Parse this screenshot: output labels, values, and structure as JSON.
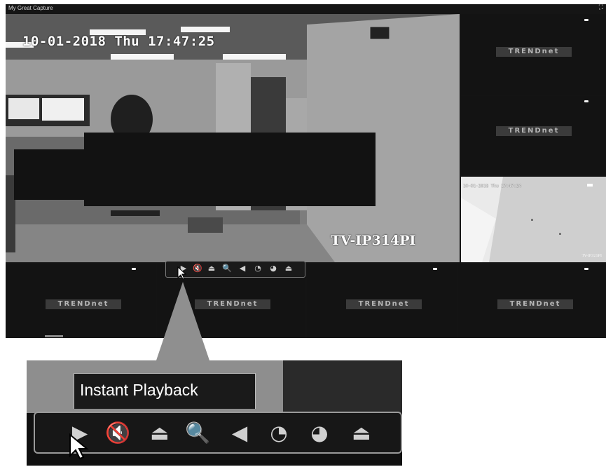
{
  "window": {
    "title": "My Great Capture",
    "controls_glyph": "⛶"
  },
  "main_camera": {
    "timestamp": "10-01-2018 Thu 17:47:25",
    "camera_label": "TV-IP314PI"
  },
  "mini_camera": {
    "timestamp": "10-01-2018 Thu 17:47:24",
    "camera_label": "TV-IP321PI"
  },
  "brand_text": "TRENDnet",
  "tiles": [
    {
      "id": "right-top",
      "brand": "TRENDnet"
    },
    {
      "id": "right-mid",
      "brand": "TRENDnet"
    },
    {
      "id": "bottom-1",
      "brand": "TRENDnet"
    },
    {
      "id": "bottom-2",
      "brand": "TRENDnet"
    },
    {
      "id": "bottom-3",
      "brand": "TRENDnet"
    },
    {
      "id": "bottom-4",
      "brand": "TRENDnet"
    }
  ],
  "toolbar": {
    "icons": [
      "instant-playback-icon",
      "audio-off-icon",
      "alarm-icon",
      "digital-zoom-icon",
      "ptz-icon",
      "capture-icon",
      "record-icon",
      "exit-icon"
    ],
    "glyphs": [
      "▶",
      "🔇",
      "⏏",
      "🔍",
      "◀",
      "◔",
      "◕",
      "⏏"
    ]
  },
  "zoom_detail": {
    "tooltip_text": "Instant Playback"
  },
  "colors": {
    "window_bg": "#141414",
    "tile_brand_bg": "#3b3b3b",
    "toolbar_border": "#9a9a9a"
  }
}
